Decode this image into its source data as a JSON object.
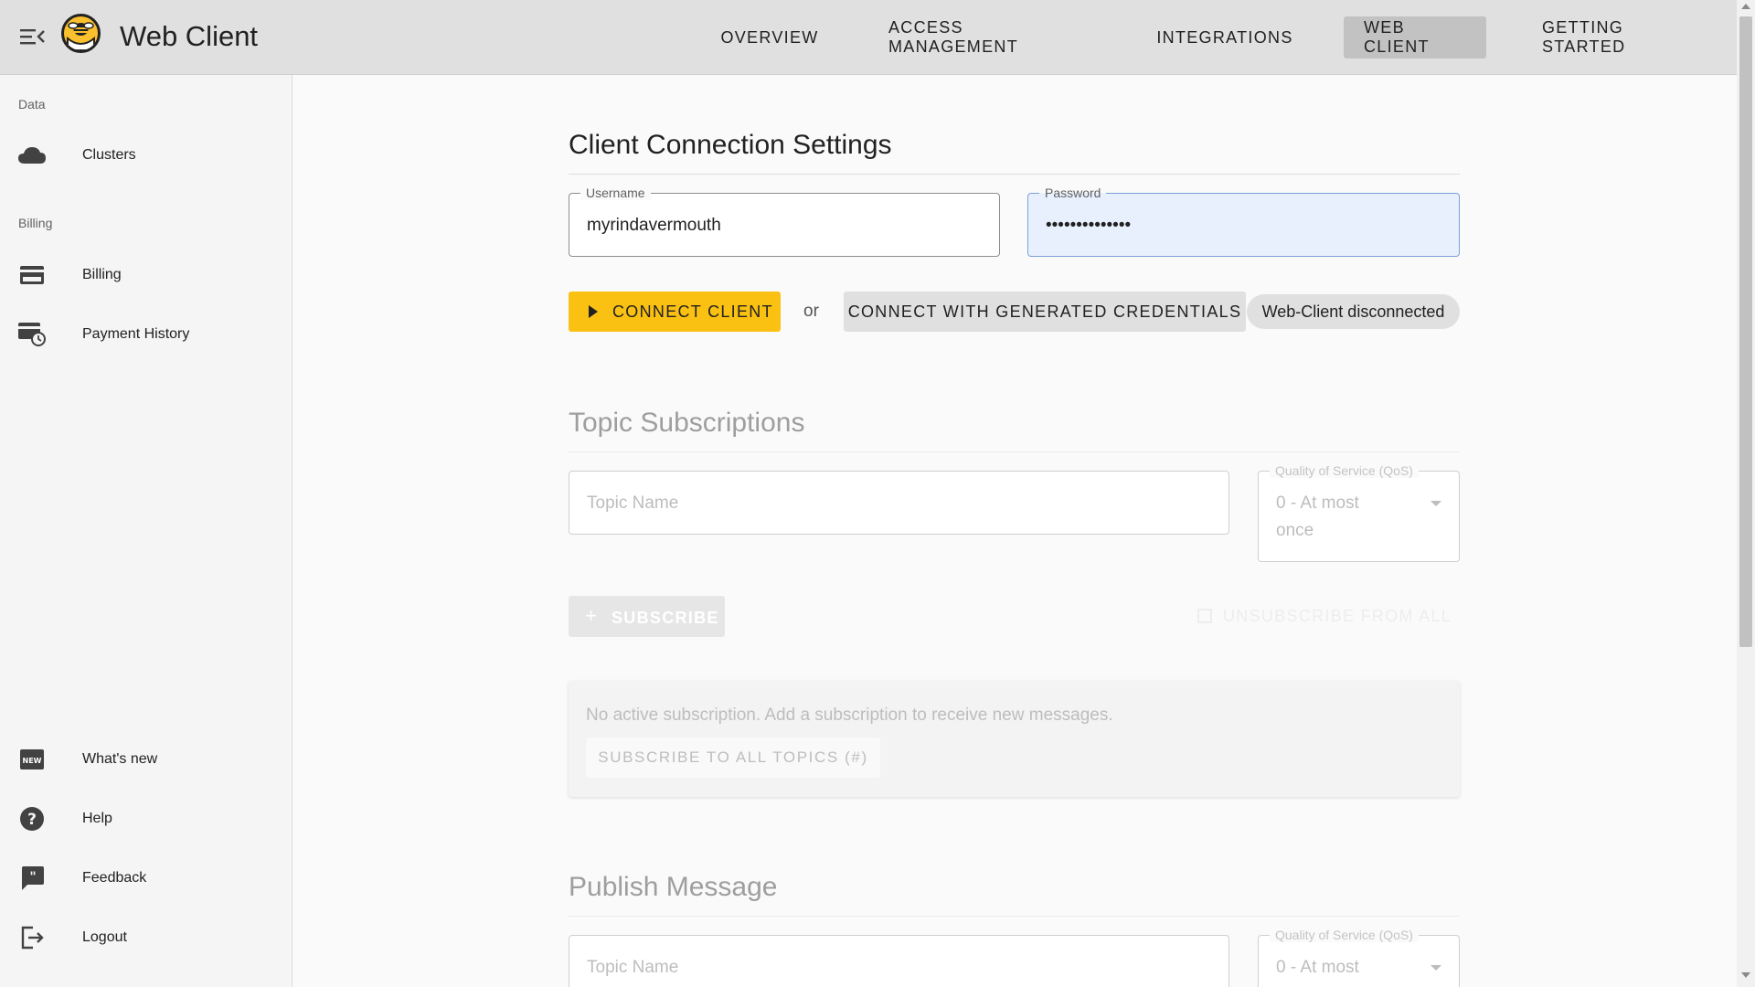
{
  "header": {
    "title": "Web Client",
    "nav": [
      {
        "label": "OVERVIEW"
      },
      {
        "label": "ACCESS MANAGEMENT"
      },
      {
        "label": "INTEGRATIONS"
      },
      {
        "label": "WEB CLIENT",
        "active": true
      },
      {
        "label": "GETTING STARTED"
      }
    ]
  },
  "sidebar": {
    "section_data": "Data",
    "section_billing": "Billing",
    "items": [
      {
        "label": "Clusters",
        "icon": "cloud-icon"
      },
      {
        "label": "Billing",
        "icon": "credit-card-icon"
      },
      {
        "label": "Payment History",
        "icon": "payment-history-icon"
      },
      {
        "label": "What's new",
        "icon": "new-badge-icon"
      },
      {
        "label": "Help",
        "icon": "help-icon"
      },
      {
        "label": "Feedback",
        "icon": "feedback-icon"
      },
      {
        "label": "Logout",
        "icon": "logout-icon"
      }
    ]
  },
  "connection": {
    "title": "Client Connection Settings",
    "username_label": "Username",
    "username_value": "myrindavermouth",
    "password_label": "Password",
    "password_value": "••••••••••••••",
    "connect_label": "CONNECT CLIENT",
    "or_text": "or",
    "generated_label": "CONNECT WITH GENERATED CREDENTIALS",
    "status": "Web-Client disconnected"
  },
  "subscriptions": {
    "title": "Topic Subscriptions",
    "topic_placeholder": "Topic Name",
    "qos_label": "Quality of Service (QoS)",
    "qos_value_line1": "0 - At most",
    "qos_value_line2": "once",
    "subscribe_label": "SUBSCRIBE",
    "unsubscribe_label": "UNSUBSCRIBE FROM ALL",
    "empty_message": "No active subscription. Add a subscription to receive new messages.",
    "subscribe_all_label": "SUBSCRIBE TO ALL TOPICS (#)"
  },
  "publish": {
    "title": "Publish Message",
    "topic_placeholder": "Topic Name",
    "qos_label": "Quality of Service (QoS)",
    "qos_value_line1": "0 - At most"
  },
  "colors": {
    "accent": "#fbc112",
    "header_bg": "#e0e0e0",
    "active_tab": "#c2c2c2",
    "sidebar_bg": "#f5f5f5"
  }
}
